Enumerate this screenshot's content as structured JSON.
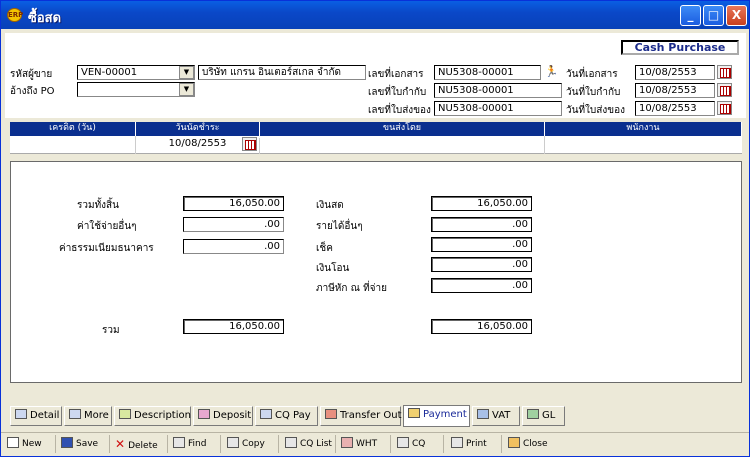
{
  "window": {
    "title": "ซื้อสด",
    "minimize": "_",
    "maximize": "□",
    "close": "X"
  },
  "badge": "Cash Purchase",
  "header": {
    "vendor_code_label": "รหัสผู้ขาย",
    "vendor_code": "VEN-00001",
    "vendor_name": "บริษัท แกรน อินเตอร์สเกล จำกัด",
    "po_ref_label": "อ้างถึง PO",
    "po_ref": "",
    "doc_no_label": "เลขที่เอกสาร",
    "doc_no": "NU5308-00001",
    "doc_date_label": "วันที่เอกสาร",
    "doc_date": "10/08/2553",
    "tax_no_label": "เลขที่ใบกำกับ",
    "tax_no": "NU5308-00001",
    "tax_date_label": "วันที่ใบกำกับ",
    "tax_date": "10/08/2553",
    "dn_no_label": "เลขที่ใบส่งของ",
    "dn_no": "NU5308-00001",
    "dn_date_label": "วันที่ใบส่งของ",
    "dn_date": "10/08/2553"
  },
  "grid": {
    "headers": [
      "เครดิต (วัน)",
      "วันนัดชำระ",
      "ขนส่งโดย",
      "พนักงาน"
    ],
    "row": {
      "credit": "",
      "due_date": "10/08/2553",
      "ship_by": "",
      "employee": ""
    }
  },
  "payment": {
    "total_label": "รวมทั้งสิ้น",
    "total": "16,050.00",
    "other_exp_label": "ค่าใช้จ่ายอื่นๆ",
    "other_exp": ".00",
    "bank_fee_label": "ค่าธรรมเนียมธนาคาร",
    "bank_fee": ".00",
    "sum_label": "รวม",
    "sum_left": "16,050.00",
    "cash_label": "เงินสด",
    "cash": "16,050.00",
    "other_income_label": "รายได้อื่นๆ",
    "other_income": ".00",
    "cheque_label": "เช็ค",
    "cheque": ".00",
    "transfer_label": "เงินโอน",
    "transfer": ".00",
    "wht_label": "ภาษีหัก ณ ที่จ่าย",
    "wht": ".00",
    "sum_right": "16,050.00"
  },
  "tabs": [
    "Detail",
    "More",
    "Description",
    "Deposit",
    "CQ Pay",
    "Transfer Out",
    "Payment",
    "VAT",
    "GL"
  ],
  "toolbar": [
    "New",
    "Save",
    "Delete",
    "Find",
    "Copy",
    "CQ List",
    "WHT",
    "CQ",
    "Print",
    "Close"
  ]
}
